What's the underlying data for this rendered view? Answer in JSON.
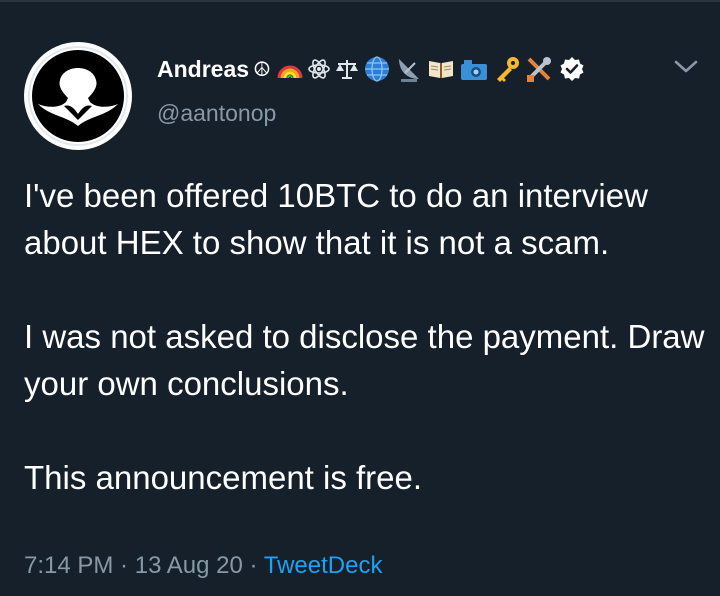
{
  "author": {
    "display_name": "Andreas",
    "name_symbol": "☮",
    "handle": "@aantonop",
    "verified": true,
    "name_emoji_icons": [
      "rainbow-icon",
      "atom-icon",
      "scales-icon",
      "globe-icon",
      "satellite-dish-icon",
      "open-book-icon",
      "camera-icon",
      "key-icon",
      "tools-icon"
    ]
  },
  "tweet": {
    "line_1": "I've been offered 10BTC to do an interview about HEX to show that it is not a scam.",
    "line_2": "I was not asked to disclose the payment. Draw your own conclusions.",
    "line_3": "This announcement is free."
  },
  "meta": {
    "time": "7:14 PM",
    "sep": " · ",
    "date": "13 Aug 20",
    "source": "TweetDeck"
  },
  "colors": {
    "background": "#15202b",
    "text": "#ffffff",
    "muted": "#8899a6",
    "link": "#1da1f2"
  }
}
